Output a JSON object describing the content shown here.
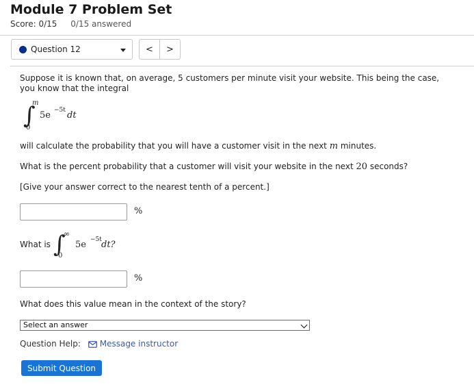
{
  "header": {
    "title": "Module 7 Problem Set",
    "score": "Score: 0/15",
    "answered": "0/15 answered"
  },
  "nav": {
    "question_label": "Question 12",
    "prev_label": "<",
    "next_label": ">",
    "status_color": "#0a2d8c"
  },
  "question": {
    "intro": "Suppose it is known that, on average, 5 customers per minute visit your website. This being the case, you know that the integral",
    "integral1": {
      "upper": "m",
      "lower": "0",
      "coef": "5e",
      "exp": "−5t",
      "dt": "dt"
    },
    "line_prob_pre": "will calculate the probability that you will have a customer visit in the next ",
    "line_prob_var": "m",
    "line_prob_post": " minutes.",
    "q1_pre": "What is the percent probability that a customer will visit your website in the next ",
    "q1_num": "20",
    "q1_post": " seconds?",
    "instruction": "[Give your answer correct to the nearest tenth of a percent.]",
    "answer1_value": "",
    "unit1": "%",
    "what_is": "What is",
    "integral2": {
      "upper": "∞",
      "lower": "0",
      "coef": "5e",
      "exp": "−5t",
      "dt": "dt?"
    },
    "answer2_value": "",
    "unit2": "%",
    "q3": "What does this value mean in the context of the story?",
    "select_value": "Select an answer"
  },
  "help": {
    "label": "Question Help:",
    "link": "Message instructor"
  },
  "submit_label": "Submit Question",
  "accent_color": "#1a74d8"
}
